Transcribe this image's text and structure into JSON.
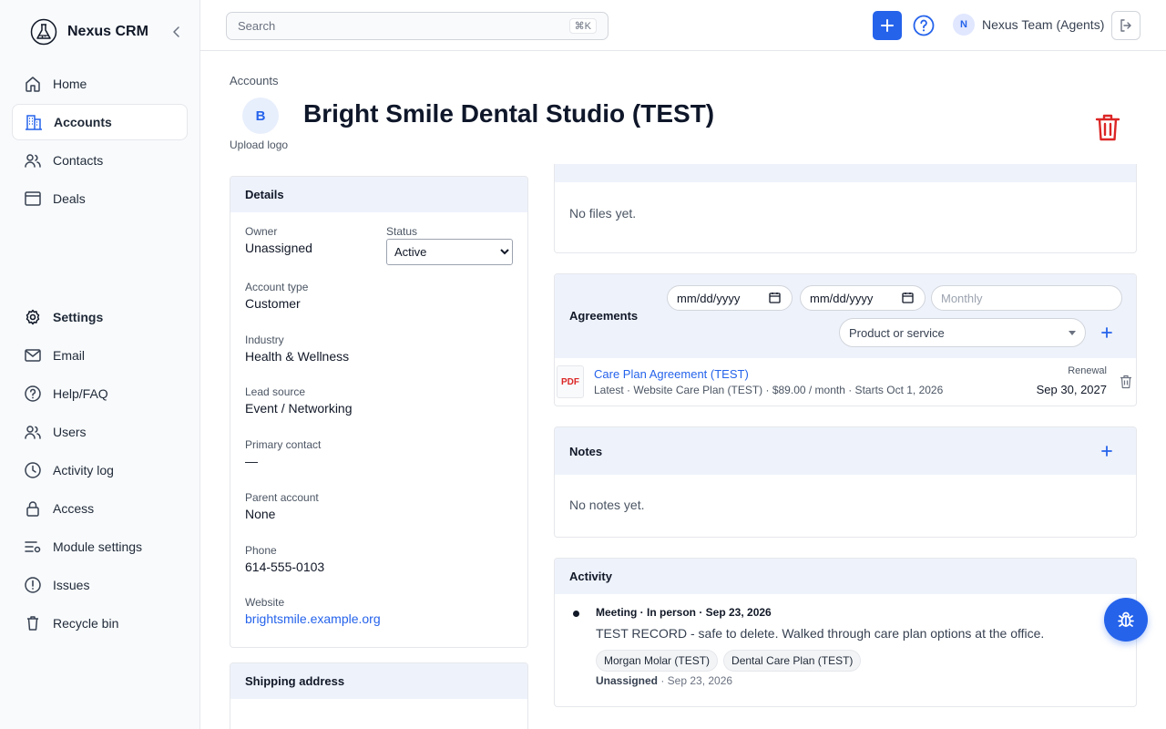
{
  "brand": {
    "name": "Nexus CRM",
    "logo_icon": "flask-icon"
  },
  "sidebar": {
    "main": [
      {
        "label": "Home",
        "icon": "home-icon"
      },
      {
        "label": "Accounts",
        "icon": "building-icon",
        "active": true
      },
      {
        "label": "Contacts",
        "icon": "contacts-icon"
      },
      {
        "label": "Deals",
        "icon": "deals-icon"
      }
    ],
    "settings_heading": "Settings",
    "settings": [
      {
        "label": "Email",
        "icon": "mail-icon"
      },
      {
        "label": "Help/FAQ",
        "icon": "help-icon"
      },
      {
        "label": "Users",
        "icon": "users-icon"
      },
      {
        "label": "Activity log",
        "icon": "clock-icon"
      },
      {
        "label": "Access",
        "icon": "lock-icon"
      },
      {
        "label": "Module settings",
        "icon": "module-settings-icon"
      },
      {
        "label": "Issues",
        "icon": "alert-icon"
      },
      {
        "label": "Recycle bin",
        "icon": "trash-icon"
      }
    ]
  },
  "topbar": {
    "search_placeholder": "Search",
    "search_shortcut": "⌘K",
    "user_initial": "N",
    "user_name": "Nexus Team (Agents)"
  },
  "header": {
    "breadcrumb": "Accounts",
    "logo_initial": "B",
    "upload_logo": "Upload logo",
    "title": "Bright Smile Dental Studio (TEST)"
  },
  "details": {
    "title": "Details",
    "owner_label": "Owner",
    "owner": "Unassigned",
    "status_label": "Status",
    "status": "Active",
    "account_type_label": "Account type",
    "account_type": "Customer",
    "industry_label": "Industry",
    "industry": "Health & Wellness",
    "lead_source_label": "Lead source",
    "lead_source": "Event / Networking",
    "primary_contact_label": "Primary contact",
    "primary_contact": "—",
    "parent_account_label": "Parent account",
    "parent_account": "None",
    "phone_label": "Phone",
    "phone": "614-555-0103",
    "website_label": "Website",
    "website": "brightsmile.example.org"
  },
  "shipping": {
    "title": "Shipping address"
  },
  "files": {
    "empty": "No files yet."
  },
  "agreements": {
    "title": "Agreements",
    "date_placeholder": "mm/dd/yyyy",
    "frequency_placeholder": "Monthly",
    "product_placeholder": "Product or service",
    "item": {
      "badge": "PDF",
      "name": "Care Plan Agreement (TEST)",
      "meta": "Latest · Website Care Plan (TEST) · $89.00 / month · Starts Oct 1, 2026",
      "renewal_label": "Renewal",
      "renewal_date": "Sep 30, 2027"
    }
  },
  "notes": {
    "title": "Notes",
    "empty": "No notes yet."
  },
  "activity": {
    "title": "Activity",
    "item": {
      "heading": "Meeting · In person · Sep 23, 2026",
      "body": "TEST RECORD - safe to delete. Walked through care plan options at the office.",
      "tags": [
        "Morgan Molar (TEST)",
        "Dental Care Plan (TEST)"
      ],
      "owner": "Unassigned",
      "date": " · Sep 23, 2026"
    }
  },
  "colors": {
    "accent": "#2563eb",
    "danger": "#dc2626",
    "panel_header": "#eef2fb"
  }
}
